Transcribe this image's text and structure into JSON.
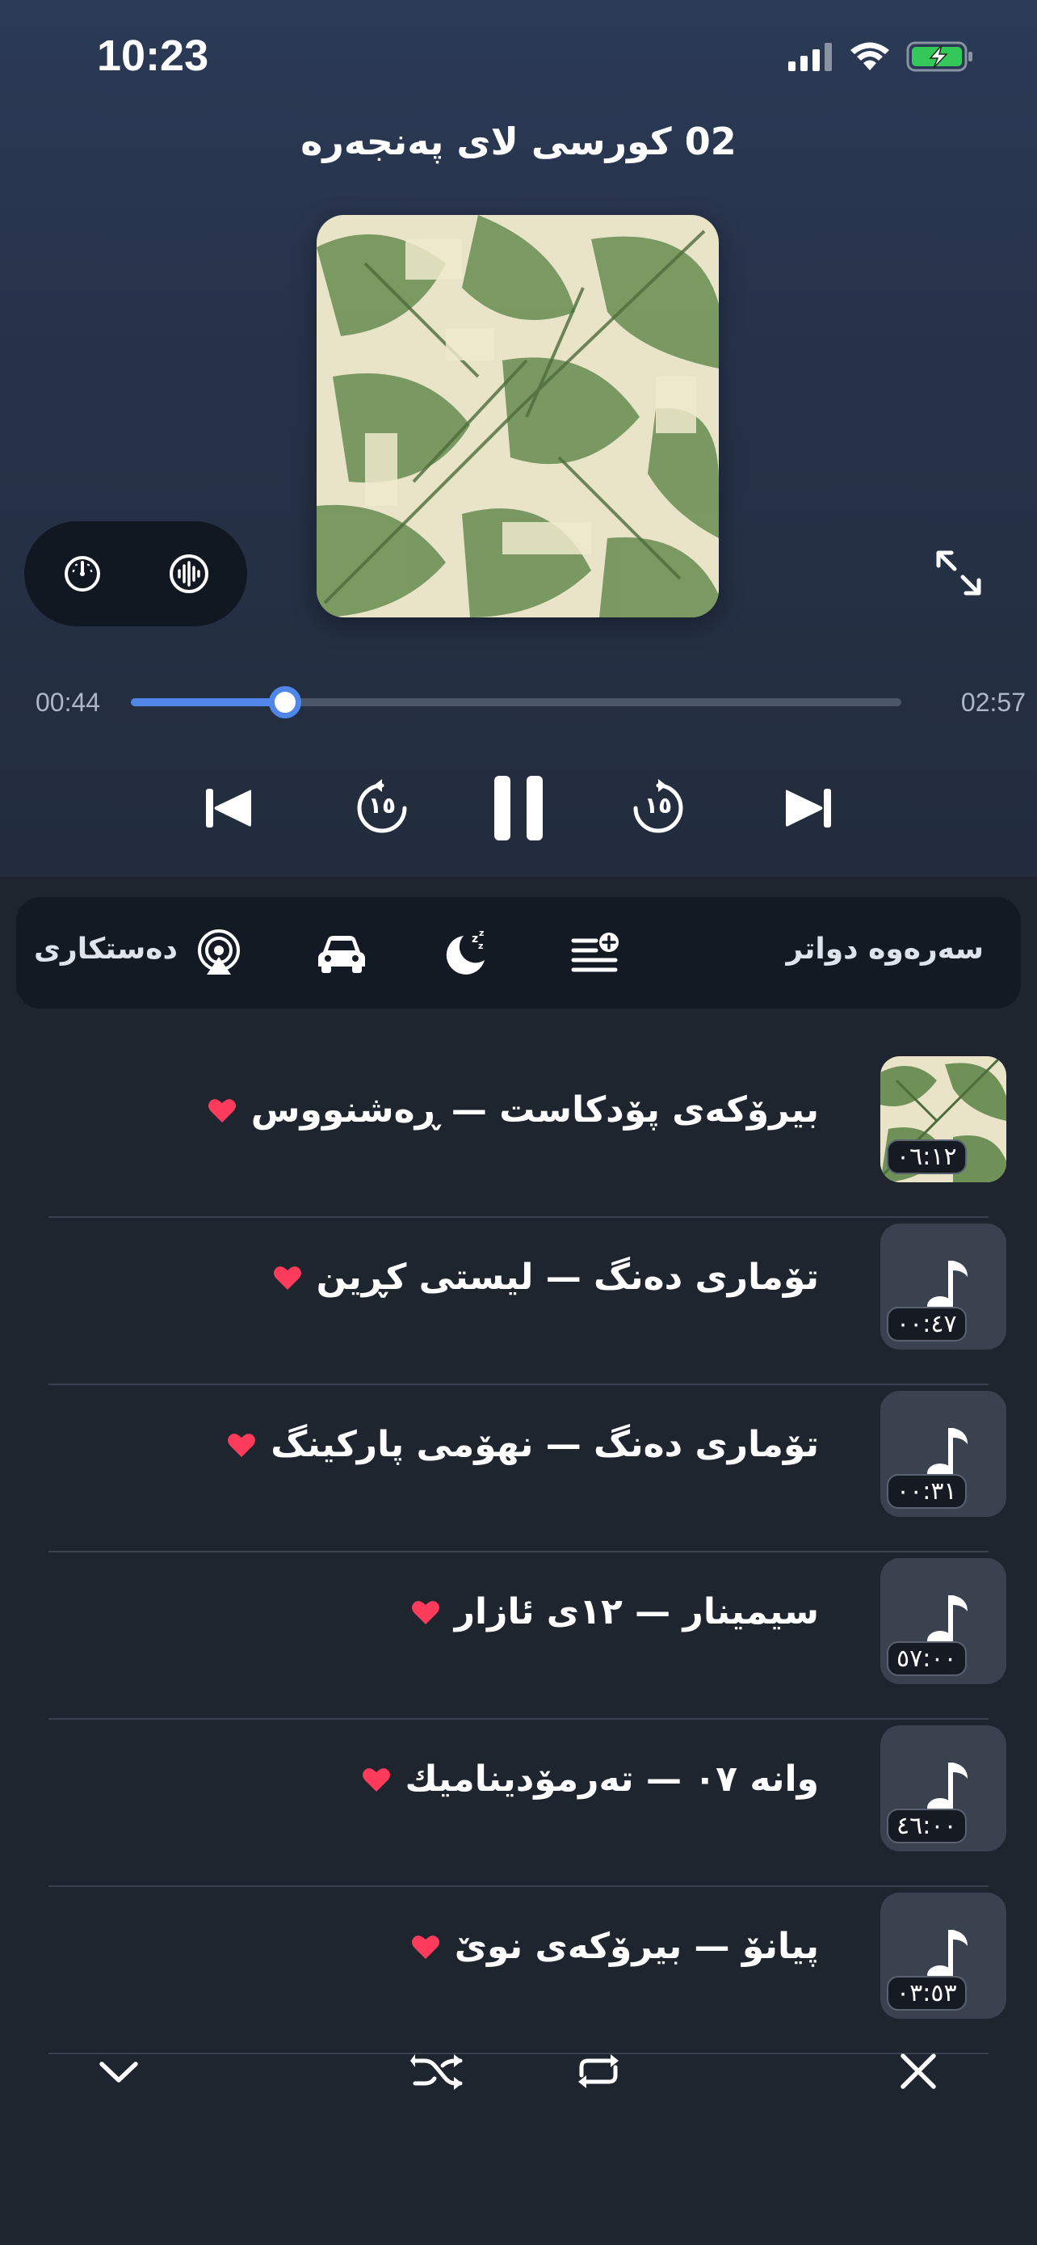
{
  "status_bar": {
    "time": "10:23"
  },
  "now_playing": {
    "title": "02 کورسی لای پەنجەرە",
    "elapsed": "00:44",
    "duration": "02:57",
    "progress": 0.2,
    "accent": "#4f86e8"
  },
  "controls": {
    "skip_back_label": "١٥",
    "skip_forward_label": "١٥"
  },
  "action_bar": {
    "left_label": "دەستکاری",
    "right_label": "سەرەوە دواتر",
    "icons": [
      "airplay-icon",
      "car-icon",
      "sleep-timer-icon",
      "add-to-queue-icon"
    ]
  },
  "queue": [
    {
      "title": "بیرۆکەی پۆدکاست — ڕەشنووس",
      "duration": "٠٦:١٢",
      "artwork": true
    },
    {
      "title": "تۆماری دەنگ — لیستی کڕین",
      "duration": "٠٠:٤٧",
      "artwork": false
    },
    {
      "title": "تۆماری دەنگ — نهۆمی پارکینگ",
      "duration": "٠٠:٣١",
      "artwork": false
    },
    {
      "title": "سیمینار — ١٢ی ئازار",
      "duration": "٥٧:٠٠",
      "artwork": false
    },
    {
      "title": "وانە ٠٧ — تەرمۆدینامیك",
      "duration": "٤٦:٠٠",
      "artwork": false
    },
    {
      "title": "پیانۆ — بیرۆکەی نوێ",
      "duration": "٠٣:٥٣",
      "artwork": false
    }
  ],
  "colors": {
    "heart": "#ff3b5c",
    "background": "#1f252f"
  }
}
